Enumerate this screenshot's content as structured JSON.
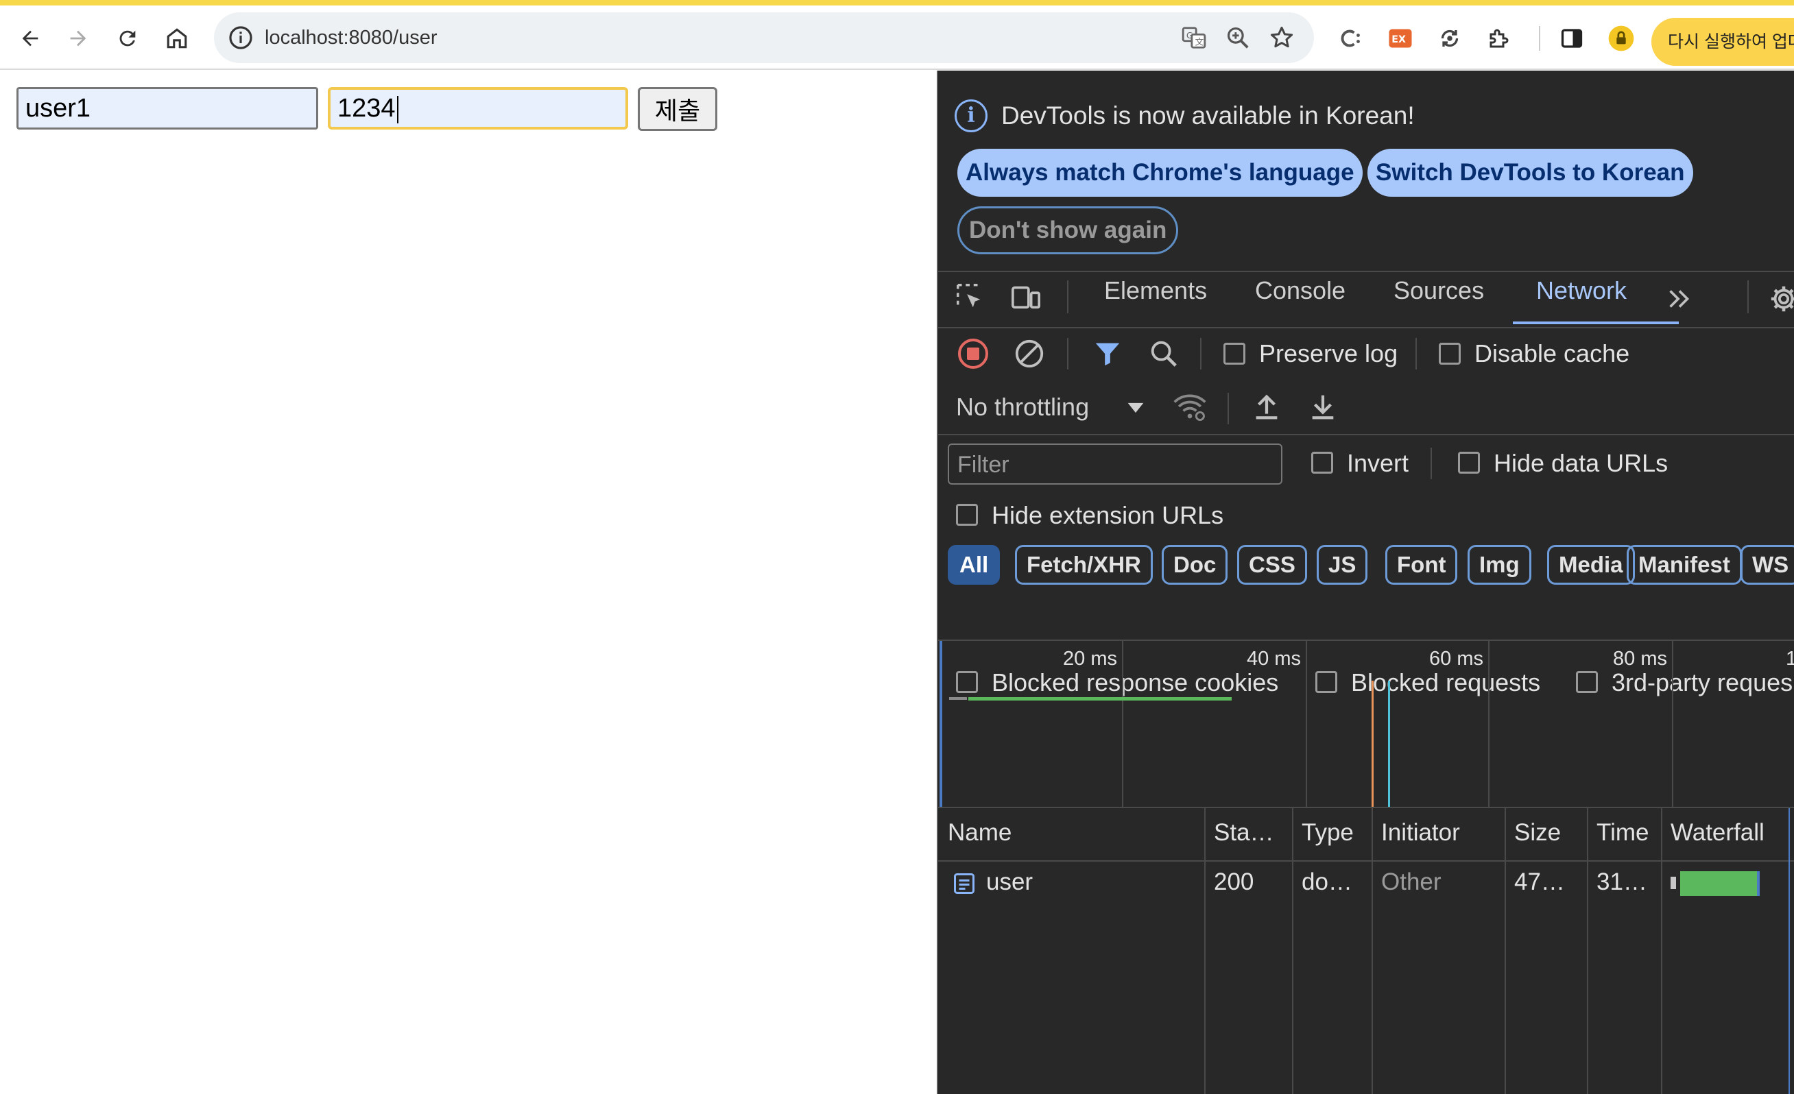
{
  "browser": {
    "url": "localhost:8080/user",
    "relaunch_label": "다시 실행하여 업데"
  },
  "page": {
    "username_value": "user1",
    "password_value": "1234",
    "submit_label": "제출"
  },
  "devtools": {
    "notice": {
      "message": "DevTools is now available in Korean!",
      "match_language_label": "Always match Chrome's language",
      "switch_korean_label": "Switch DevTools to Korean",
      "dont_show_label": "Don't show again"
    },
    "tabs": [
      "Elements",
      "Console",
      "Sources",
      "Network"
    ],
    "active_tab": "Network",
    "network": {
      "preserve_log_label": "Preserve log",
      "disable_cache_label": "Disable cache",
      "throttling_value": "No throttling",
      "filter_placeholder": "Filter",
      "invert_label": "Invert",
      "hide_data_urls_label": "Hide data URLs",
      "hide_extension_urls_label": "Hide extension URLs",
      "type_filters": [
        "All",
        "Fetch/XHR",
        "Doc",
        "CSS",
        "JS",
        "Font",
        "Img",
        "Media",
        "Manifest",
        "WS"
      ],
      "active_type_filter": "All",
      "blocked_cookies_label": "Blocked response cookies",
      "blocked_requests_label": "Blocked requests",
      "third_party_label": "3rd-party reques",
      "timeline_ticks": [
        "20 ms",
        "40 ms",
        "60 ms",
        "80 ms",
        "1"
      ],
      "columns": [
        "Name",
        "Sta…",
        "Type",
        "Initiator",
        "Size",
        "Time",
        "Waterfall"
      ],
      "rows": [
        {
          "name": "user",
          "status": "200",
          "type": "do…",
          "initiator": "Other",
          "size": "47…",
          "time": "31…"
        }
      ]
    }
  },
  "colors": {
    "accent": "#a8c7fa",
    "devtools_bg": "#282828",
    "waterfall_green": "#5cb85c",
    "record_red": "#e46962"
  }
}
